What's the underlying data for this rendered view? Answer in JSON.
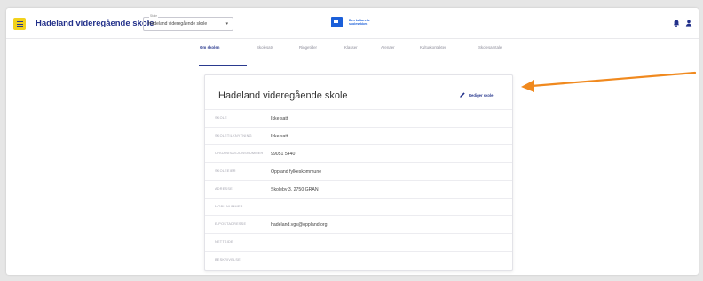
{
  "app": {
    "school_name": "Hadeland videregående skole",
    "school_select": {
      "floating_label": "Skole",
      "value": "Hadeland videregående skole"
    },
    "brand_line1": "Den kulturelle",
    "brand_line2": "skolesekken"
  },
  "tabs": [
    {
      "label": "Om skolen",
      "active": true
    },
    {
      "label": "Skolesats"
    },
    {
      "label": "Ringetider"
    },
    {
      "label": "Klasser"
    },
    {
      "label": "Arenaer"
    },
    {
      "label": "Kulturkontakter"
    },
    {
      "label": "Skolesamtale"
    }
  ],
  "card": {
    "title": "Hadeland videregående skole",
    "edit_label": "Rediger skole",
    "rows": [
      {
        "label": "SKOLE",
        "value": "Ikke satt"
      },
      {
        "label": "SKOLETILKNYTNING",
        "value": "Ikke satt"
      },
      {
        "label": "ORGANISASJONSNUMMER",
        "value": "99051 5440"
      },
      {
        "label": "SKOLEEIER",
        "value": "Oppland fylkeskommune"
      },
      {
        "label": "ADRESSE",
        "value": "Skoleby 3, 2750 GRAN"
      },
      {
        "label": "MOBILNUMMER",
        "value": ""
      },
      {
        "label": "E-POSTADRESSE",
        "value": "hadeland.vgs@oppland.org"
      },
      {
        "label": "NETTSIDE",
        "value": ""
      },
      {
        "label": "BESKRIVELSE",
        "value": ""
      }
    ]
  },
  "colors": {
    "accent": "#22308a",
    "menu_button": "#f2d21c",
    "brand_blue": "#1b5fd9",
    "arrow": "#f0891e"
  },
  "icons": [
    "menu-icon",
    "chevron-down-icon",
    "bell-icon",
    "user-icon",
    "pencil-icon"
  ]
}
